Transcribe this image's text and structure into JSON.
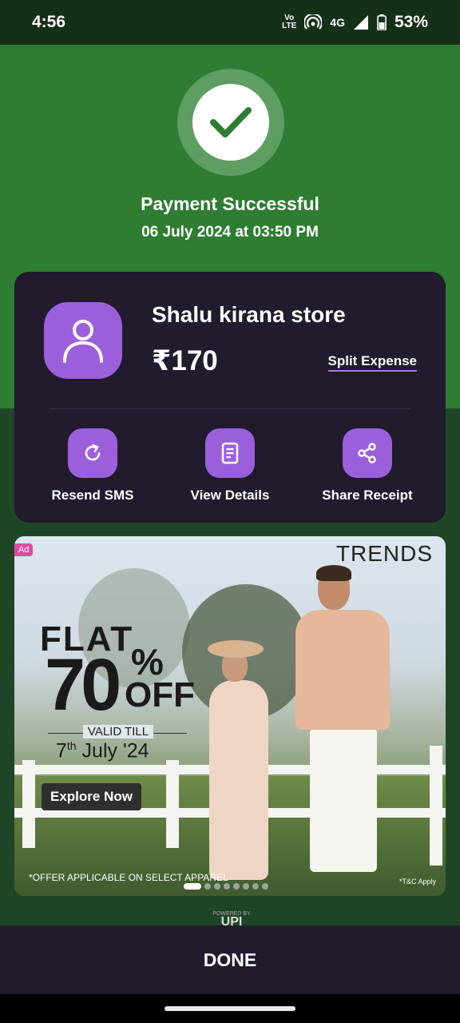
{
  "status_bar": {
    "time": "4:56",
    "volte_top": "Vo",
    "volte_bottom": "LTE",
    "network": "4G",
    "battery": "53%",
    "icons": [
      "volte-icon",
      "hotspot-icon",
      "signal-icon",
      "battery-icon"
    ]
  },
  "payment": {
    "title": "Payment Successful",
    "date": "06 July 2024 at 03:50 PM"
  },
  "transaction": {
    "merchant": "Shalu kirana store",
    "amount": "₹170",
    "split_label": "Split Expense"
  },
  "actions": [
    {
      "label": "Resend SMS",
      "icon": "refresh-icon"
    },
    {
      "label": "View Details",
      "icon": "document-icon"
    },
    {
      "label": "Share Receipt",
      "icon": "share-icon"
    }
  ],
  "ad": {
    "tag": "Ad",
    "brand": "TRENDS",
    "flat": "FLAT",
    "percent_number": "70",
    "percent_sign": "%",
    "off": "OFF",
    "valid": "VALID TILL",
    "date_day": "7",
    "date_sup": "th",
    "date_rest": " July '24",
    "cta": "Explore Now",
    "disclaimer": "*OFFER APPLICABLE ON SELECT APPAREL",
    "tnc": "*T&C Apply",
    "carousel_count": 8,
    "carousel_active": 1
  },
  "footer": {
    "powered_by": "POWERED BY",
    "upi": "UPI",
    "done_label": "DONE"
  },
  "colors": {
    "top_green": "#2e7d32",
    "bottom_green": "#1f4527",
    "card": "#221a2d",
    "accent_purple": "#9c5fdc",
    "check_green": "#2e7d32"
  }
}
